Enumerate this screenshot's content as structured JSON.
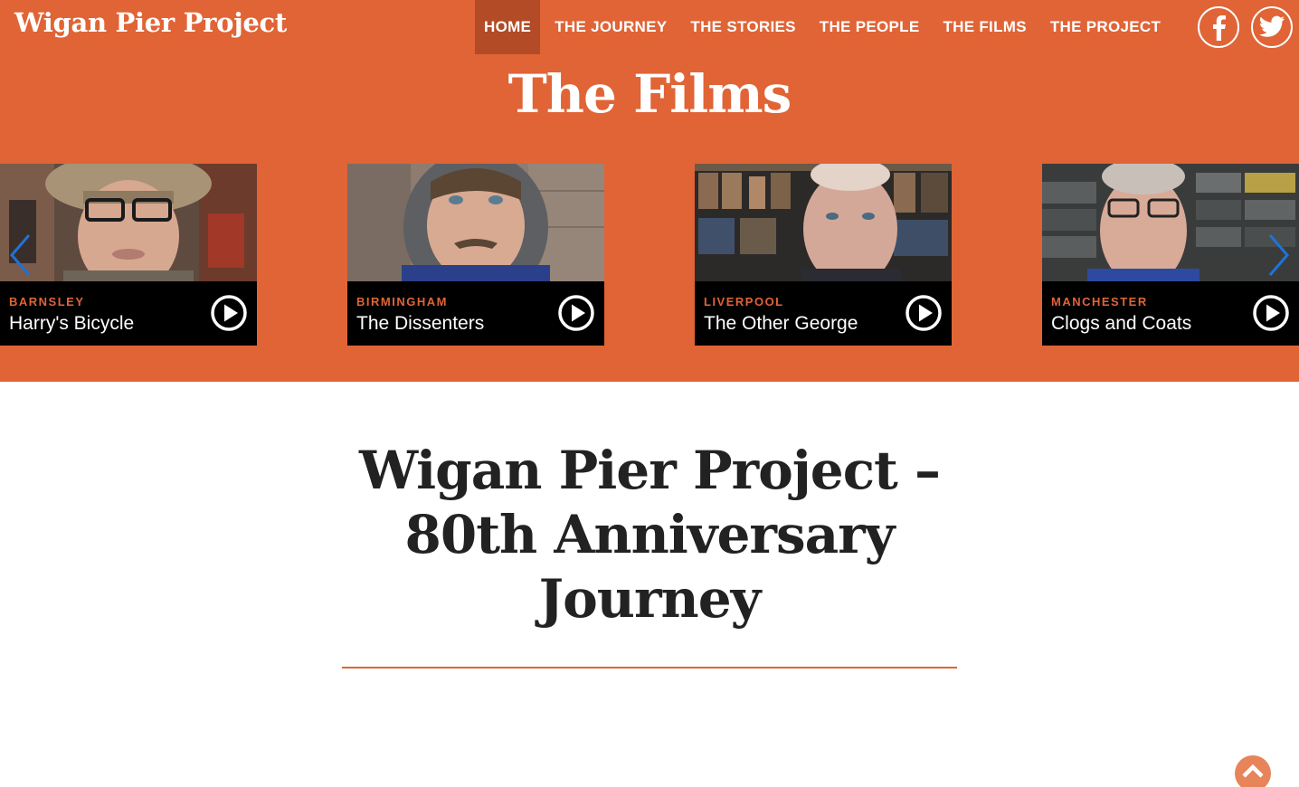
{
  "site": {
    "logo": "Wigan Pier Project"
  },
  "nav": {
    "items": [
      {
        "label": "HOME",
        "active": true
      },
      {
        "label": "THE JOURNEY",
        "active": false
      },
      {
        "label": "THE STORIES",
        "active": false
      },
      {
        "label": "THE PEOPLE",
        "active": false
      },
      {
        "label": "THE FILMS",
        "active": false
      },
      {
        "label": "THE PROJECT",
        "active": false
      }
    ],
    "social": [
      {
        "icon": "facebook-icon"
      },
      {
        "icon": "twitter-icon"
      }
    ]
  },
  "films": {
    "heading": "The Films",
    "cards": [
      {
        "city": "BARNSLEY",
        "title": "Harry's Bicycle"
      },
      {
        "city": "BIRMINGHAM",
        "title": "The Dissenters"
      },
      {
        "city": "LIVERPOOL",
        "title": "The Other George"
      },
      {
        "city": "MANCHESTER",
        "title": "Clogs and Coats"
      }
    ],
    "prev_icon": "chevron-left-icon",
    "next_icon": "chevron-right-icon"
  },
  "article": {
    "title": "Wigan Pier Project – 80th Anniversary Journey"
  },
  "back_to_top_icon": "chevron-up-icon",
  "colors": {
    "brand": "#e06436",
    "nav_active": "#b24b26",
    "arrow": "#1e73d8"
  }
}
